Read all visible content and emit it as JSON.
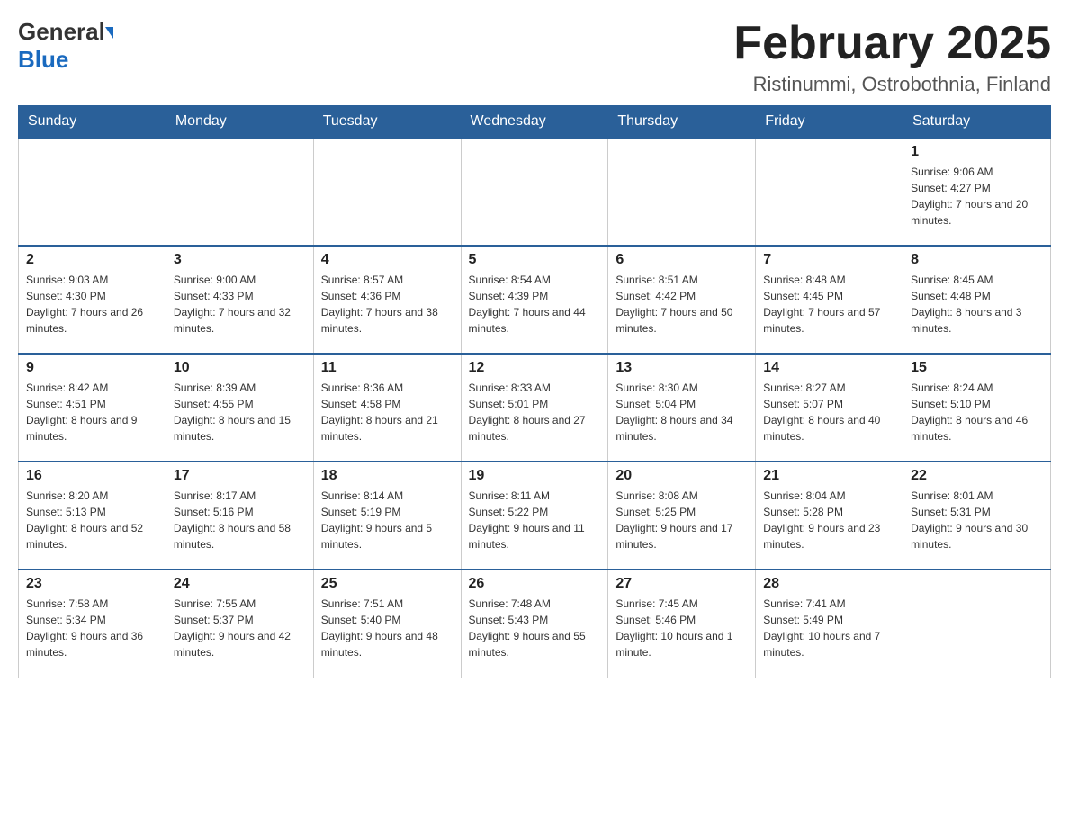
{
  "header": {
    "logo_general": "General",
    "logo_blue": "Blue",
    "month_title": "February 2025",
    "location": "Ristinummi, Ostrobothnia, Finland"
  },
  "days_of_week": [
    "Sunday",
    "Monday",
    "Tuesday",
    "Wednesday",
    "Thursday",
    "Friday",
    "Saturday"
  ],
  "weeks": [
    {
      "days": [
        {
          "num": "",
          "info": ""
        },
        {
          "num": "",
          "info": ""
        },
        {
          "num": "",
          "info": ""
        },
        {
          "num": "",
          "info": ""
        },
        {
          "num": "",
          "info": ""
        },
        {
          "num": "",
          "info": ""
        },
        {
          "num": "1",
          "info": "Sunrise: 9:06 AM\nSunset: 4:27 PM\nDaylight: 7 hours and 20 minutes."
        }
      ]
    },
    {
      "days": [
        {
          "num": "2",
          "info": "Sunrise: 9:03 AM\nSunset: 4:30 PM\nDaylight: 7 hours and 26 minutes."
        },
        {
          "num": "3",
          "info": "Sunrise: 9:00 AM\nSunset: 4:33 PM\nDaylight: 7 hours and 32 minutes."
        },
        {
          "num": "4",
          "info": "Sunrise: 8:57 AM\nSunset: 4:36 PM\nDaylight: 7 hours and 38 minutes."
        },
        {
          "num": "5",
          "info": "Sunrise: 8:54 AM\nSunset: 4:39 PM\nDaylight: 7 hours and 44 minutes."
        },
        {
          "num": "6",
          "info": "Sunrise: 8:51 AM\nSunset: 4:42 PM\nDaylight: 7 hours and 50 minutes."
        },
        {
          "num": "7",
          "info": "Sunrise: 8:48 AM\nSunset: 4:45 PM\nDaylight: 7 hours and 57 minutes."
        },
        {
          "num": "8",
          "info": "Sunrise: 8:45 AM\nSunset: 4:48 PM\nDaylight: 8 hours and 3 minutes."
        }
      ]
    },
    {
      "days": [
        {
          "num": "9",
          "info": "Sunrise: 8:42 AM\nSunset: 4:51 PM\nDaylight: 8 hours and 9 minutes."
        },
        {
          "num": "10",
          "info": "Sunrise: 8:39 AM\nSunset: 4:55 PM\nDaylight: 8 hours and 15 minutes."
        },
        {
          "num": "11",
          "info": "Sunrise: 8:36 AM\nSunset: 4:58 PM\nDaylight: 8 hours and 21 minutes."
        },
        {
          "num": "12",
          "info": "Sunrise: 8:33 AM\nSunset: 5:01 PM\nDaylight: 8 hours and 27 minutes."
        },
        {
          "num": "13",
          "info": "Sunrise: 8:30 AM\nSunset: 5:04 PM\nDaylight: 8 hours and 34 minutes."
        },
        {
          "num": "14",
          "info": "Sunrise: 8:27 AM\nSunset: 5:07 PM\nDaylight: 8 hours and 40 minutes."
        },
        {
          "num": "15",
          "info": "Sunrise: 8:24 AM\nSunset: 5:10 PM\nDaylight: 8 hours and 46 minutes."
        }
      ]
    },
    {
      "days": [
        {
          "num": "16",
          "info": "Sunrise: 8:20 AM\nSunset: 5:13 PM\nDaylight: 8 hours and 52 minutes."
        },
        {
          "num": "17",
          "info": "Sunrise: 8:17 AM\nSunset: 5:16 PM\nDaylight: 8 hours and 58 minutes."
        },
        {
          "num": "18",
          "info": "Sunrise: 8:14 AM\nSunset: 5:19 PM\nDaylight: 9 hours and 5 minutes."
        },
        {
          "num": "19",
          "info": "Sunrise: 8:11 AM\nSunset: 5:22 PM\nDaylight: 9 hours and 11 minutes."
        },
        {
          "num": "20",
          "info": "Sunrise: 8:08 AM\nSunset: 5:25 PM\nDaylight: 9 hours and 17 minutes."
        },
        {
          "num": "21",
          "info": "Sunrise: 8:04 AM\nSunset: 5:28 PM\nDaylight: 9 hours and 23 minutes."
        },
        {
          "num": "22",
          "info": "Sunrise: 8:01 AM\nSunset: 5:31 PM\nDaylight: 9 hours and 30 minutes."
        }
      ]
    },
    {
      "days": [
        {
          "num": "23",
          "info": "Sunrise: 7:58 AM\nSunset: 5:34 PM\nDaylight: 9 hours and 36 minutes."
        },
        {
          "num": "24",
          "info": "Sunrise: 7:55 AM\nSunset: 5:37 PM\nDaylight: 9 hours and 42 minutes."
        },
        {
          "num": "25",
          "info": "Sunrise: 7:51 AM\nSunset: 5:40 PM\nDaylight: 9 hours and 48 minutes."
        },
        {
          "num": "26",
          "info": "Sunrise: 7:48 AM\nSunset: 5:43 PM\nDaylight: 9 hours and 55 minutes."
        },
        {
          "num": "27",
          "info": "Sunrise: 7:45 AM\nSunset: 5:46 PM\nDaylight: 10 hours and 1 minute."
        },
        {
          "num": "28",
          "info": "Sunrise: 7:41 AM\nSunset: 5:49 PM\nDaylight: 10 hours and 7 minutes."
        },
        {
          "num": "",
          "info": ""
        }
      ]
    }
  ]
}
